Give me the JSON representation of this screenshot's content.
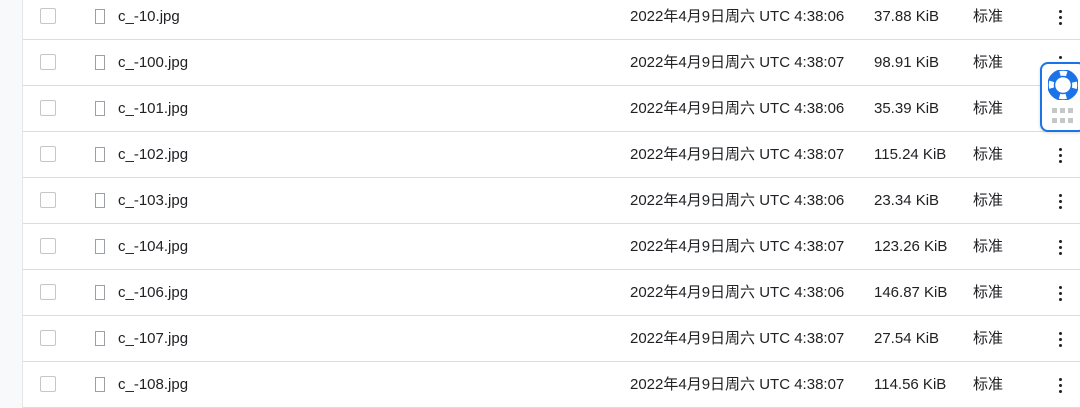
{
  "files": [
    {
      "name": "c_-10.jpg",
      "created": "2022年4月9日周六 UTC 4:38:06",
      "size": "37.88 KiB",
      "storage_class": "标准"
    },
    {
      "name": "c_-100.jpg",
      "created": "2022年4月9日周六 UTC 4:38:07",
      "size": "98.91 KiB",
      "storage_class": "标准"
    },
    {
      "name": "c_-101.jpg",
      "created": "2022年4月9日周六 UTC 4:38:06",
      "size": "35.39 KiB",
      "storage_class": "标准"
    },
    {
      "name": "c_-102.jpg",
      "created": "2022年4月9日周六 UTC 4:38:07",
      "size": "115.24 KiB",
      "storage_class": "标准"
    },
    {
      "name": "c_-103.jpg",
      "created": "2022年4月9日周六 UTC 4:38:06",
      "size": "23.34 KiB",
      "storage_class": "标准"
    },
    {
      "name": "c_-104.jpg",
      "created": "2022年4月9日周六 UTC 4:38:07",
      "size": "123.26 KiB",
      "storage_class": "标准"
    },
    {
      "name": "c_-106.jpg",
      "created": "2022年4月9日周六 UTC 4:38:06",
      "size": "146.87 KiB",
      "storage_class": "标准"
    },
    {
      "name": "c_-107.jpg",
      "created": "2022年4月9日周六 UTC 4:38:07",
      "size": "27.54 KiB",
      "storage_class": "标准"
    },
    {
      "name": "c_-108.jpg",
      "created": "2022年4月9日周六 UTC 4:38:07",
      "size": "114.56 KiB",
      "storage_class": "标准"
    }
  ],
  "icons": {
    "checkbox": "checkbox-icon",
    "file": "file-icon",
    "more": "more-vert-icon",
    "help": "lifebuoy-icon",
    "apps": "grid-dots-icon"
  },
  "colors": {
    "divider": "#dadce0",
    "accent": "#1a73e8"
  }
}
